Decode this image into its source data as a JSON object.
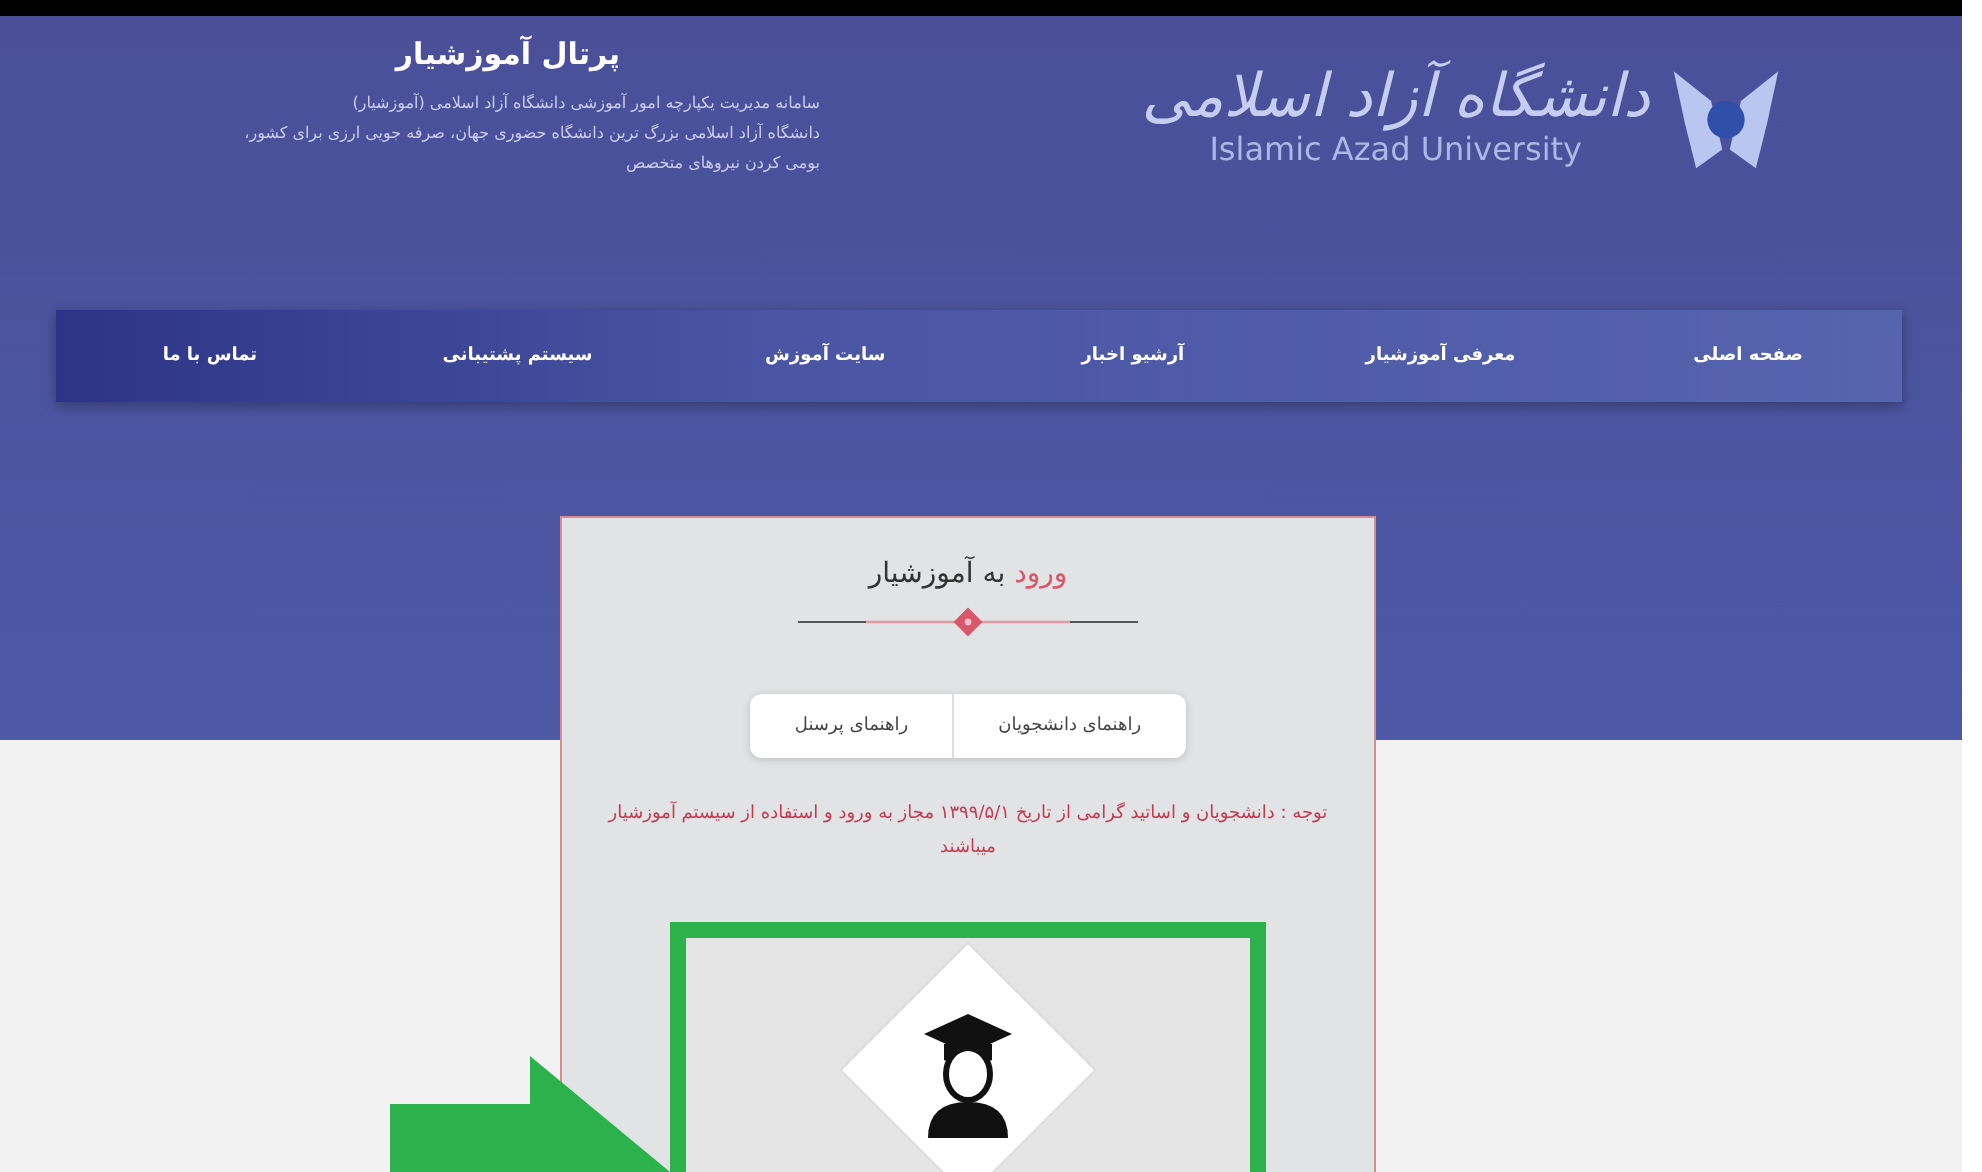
{
  "header": {
    "title": "پرتال آموزشیار",
    "description": [
      "سامانه مدیریت یکپارچه امور آموزشی دانشگاه آزاد اسلامی (آموزشیار)",
      "دانشگاه آزاد اسلامی بزرگ ترین دانشگاه حضوری جهان، صرفه جویی ارزی برای کشور،",
      "بومی کردن نیروهای متخصص"
    ],
    "logo_fa": "دانشگاه آزاد اسلامی",
    "logo_en": "Islamic Azad University"
  },
  "nav": {
    "items": [
      {
        "label": "صفحه اصلی"
      },
      {
        "label": "معرفی آموزشیار"
      },
      {
        "label": "آرشیو اخبار"
      },
      {
        "label": "سایت آموزش"
      },
      {
        "label": "سیستم پشتیبانی"
      },
      {
        "label": "تماس با ما"
      }
    ]
  },
  "login": {
    "title_highlight": "ورود",
    "title_rest": "به آموزشیار",
    "guides": [
      "راهنمای دانشجویان",
      "راهنمای پرسنل"
    ],
    "notice": "توجه : دانشجویان و اساتید گرامی از تاریخ ۱۳۹۹/۵/۱ مجاز به ورود و استفاده از سیستم آموزشیار میباشند"
  }
}
